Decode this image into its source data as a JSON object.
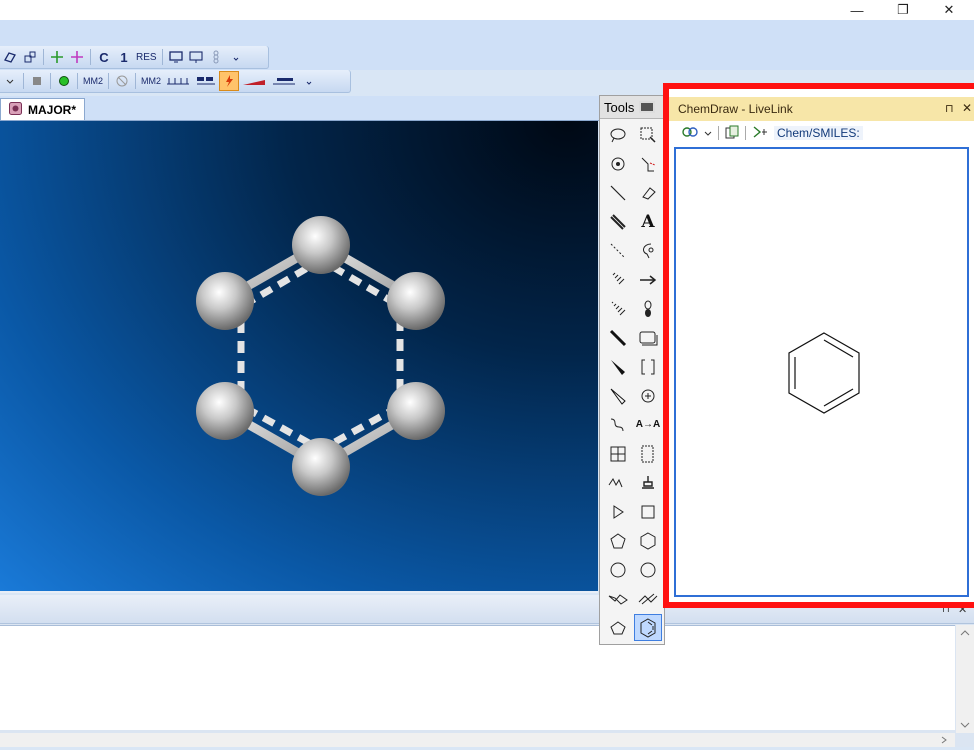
{
  "window": {
    "minimize_glyph": "—",
    "restore_glyph": "❐",
    "close_glyph": "✕"
  },
  "toolbar_row1": {
    "c_label": "C",
    "one_label": "1",
    "res_label": "RES"
  },
  "toolbar_row2": {
    "mm2_label": "MM2",
    "mm2b_label": "MM2"
  },
  "document_tab": {
    "label": "MAJOR*"
  },
  "tools_panel": {
    "title": "Tools",
    "text_tool_glyph": "A",
    "arrow_aa_glyph": "A→A"
  },
  "livelink": {
    "title": "ChemDraw - LiveLink",
    "pin_glyph": "⊓",
    "close_glyph": "✕",
    "smiles_label": "Chem/SMILES:"
  },
  "output_panel": {
    "pin_glyph": "⊓",
    "close_glyph": "✕"
  },
  "colors": {
    "highlight_border": "#ff1111",
    "accent_blue": "#2f6fd6",
    "livelink_title_bg": "#f7e6a8"
  }
}
